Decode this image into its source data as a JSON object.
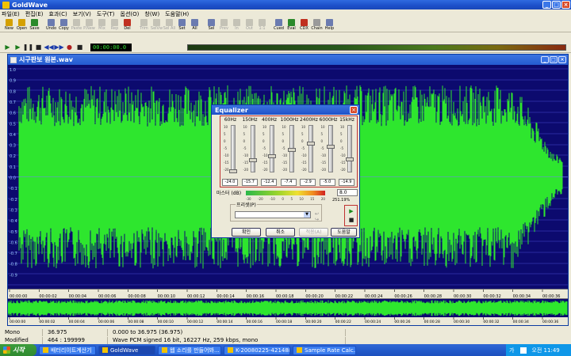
{
  "app": {
    "title": "GoldWave",
    "menu": [
      "파일(E)",
      "편집(E)",
      "효과(C)",
      "보기(V)",
      "도구(T)",
      "옵션(O)",
      "창(W)",
      "도움말(H)"
    ]
  },
  "toolbar": {
    "buttons": [
      "New",
      "Open",
      "Save",
      "Undo",
      "Copy",
      "Paste",
      "P.New",
      "Mix",
      "Rep",
      "Del",
      "Trim",
      "SelVw",
      "Sel All",
      "Set",
      "All",
      "Sel",
      "Prev",
      "In",
      "Out",
      "1:1",
      "Cued",
      "Eval",
      "CDX",
      "Chain",
      "Help"
    ]
  },
  "transport": {
    "time": "00:00:00.0"
  },
  "document": {
    "title": "시구판보 원본.wav",
    "vscale": [
      "1.0",
      "0.9",
      "0.8",
      "0.7",
      "0.6",
      "0.5",
      "0.4",
      "0.3",
      "0.2",
      "0.1",
      "0.0",
      "-0.1",
      "-0.2",
      "-0.3",
      "-0.4",
      "-0.5",
      "-0.6",
      "-0.7",
      "-0.8",
      "-0.9"
    ],
    "timeline": [
      "00:00:00",
      "00:00:02",
      "00:00:04",
      "00:00:06",
      "00:00:08",
      "00:00:10",
      "00:00:12",
      "00:00:14",
      "00:00:16",
      "00:00:18",
      "00:00:20",
      "00:00:22",
      "00:00:24",
      "00:00:26",
      "00:00:28",
      "00:00:30",
      "00:00:32",
      "00:00:34",
      "00:00:36"
    ]
  },
  "equalizer": {
    "title": "Equalizer",
    "bands": [
      {
        "freq": "60Hz",
        "value": "-24.0"
      },
      {
        "freq": "150Hz",
        "value": "-15.7"
      },
      {
        "freq": "400Hz",
        "value": "-12.4"
      },
      {
        "freq": "1000Hz",
        "value": "-7.4"
      },
      {
        "freq": "2400Hz",
        "value": "-2.9"
      },
      {
        "freq": "6000Hz",
        "value": "-5.0"
      },
      {
        "freq": "15kHz",
        "value": "-14.9"
      }
    ],
    "band_scale": [
      "10",
      "5",
      "0",
      "-5",
      "-10",
      "-15",
      "-20"
    ],
    "master_label": "마스터 (dB)",
    "master_value": "8.0",
    "master_percent": "251.19%",
    "master_scale": [
      "-30",
      "-20",
      "-10",
      "0",
      "5",
      "10",
      "15",
      "20"
    ],
    "preset_label": "프리셋(P)",
    "buttons": {
      "ok": "확인",
      "cancel": "취소",
      "apply": "적용(A)",
      "help": "도움말"
    }
  },
  "status": {
    "channel": "Mono",
    "length": "36.975",
    "selection": "0.000 to 36.975 (36.975)",
    "modified": "Modified",
    "position": "464 : 199999",
    "format": "Wave PCM signed 16 bit, 16227 Hz, 259 kbps, mono"
  },
  "taskbar": {
    "start": "시작",
    "tasks": [
      "배터리이트계산기",
      "GoldWave",
      "웹 소리를 만들어봐...",
      "K-20080225-421488...",
      "Sample Rate Calc..."
    ],
    "ime": "가",
    "clock": "오전 11:49"
  },
  "colors": {
    "waveform": "#2ee62e",
    "wave_bg": "#0c0a6e",
    "titlebar": "#2f6be0"
  }
}
